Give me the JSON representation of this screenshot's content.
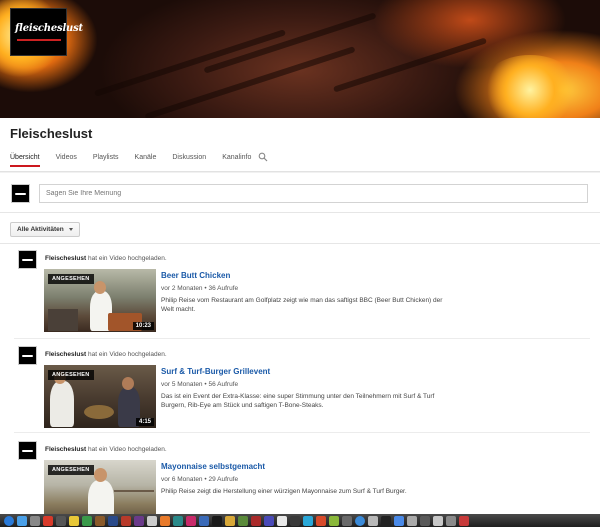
{
  "channel": {
    "logo_text": "fleischeslust",
    "title": "Fleischeslust"
  },
  "tabs": [
    {
      "label": "Übersicht",
      "active": true
    },
    {
      "label": "Videos",
      "active": false
    },
    {
      "label": "Playlists",
      "active": false
    },
    {
      "label": "Kanäle",
      "active": false
    },
    {
      "label": "Diskussion",
      "active": false
    },
    {
      "label": "Kanalinfo",
      "active": false
    }
  ],
  "share": {
    "placeholder": "Sagen Sie Ihre Meinung"
  },
  "filter": {
    "label": "Alle Aktivitäten"
  },
  "feed": [
    {
      "uploader": "Fleischeslust",
      "action": "hat ein Video hochgeladen.",
      "badge": "ANGESEHEN",
      "duration": "10:23",
      "title": "Beer Butt Chicken",
      "age": "vor 2 Monaten",
      "views": "36 Aufrufe",
      "description": "Philip Reise vom Restaurant am Golfplatz zeigt wie man das saftigst BBC (Beer Butt Chicken) der Welt macht."
    },
    {
      "uploader": "Fleischeslust",
      "action": "hat ein Video hochgeladen.",
      "badge": "ANGESEHEN",
      "duration": "4:15",
      "title": "Surf & Turf-Burger Grillevent",
      "age": "vor 5 Monaten",
      "views": "56 Aufrufe",
      "description": "Das ist ein Event der Extra-Klasse: eine super Stimmung unter den Teilnehmern mit Surf & Turf Burgern, Rib-Eye am Stück und saftigen T-Bone-Steaks."
    },
    {
      "uploader": "Fleischeslust",
      "action": "hat ein Video hochgeladen.",
      "badge": "ANGESEHEN",
      "duration": "",
      "title": "Mayonnaise selbstgemacht",
      "age": "vor 6 Monaten",
      "views": "29 Aufrufe",
      "description": "Philip Reise zeigt die Herstellung einer würzigen Mayonnaise zum Surf & Turf Burger."
    }
  ],
  "meta_separator": "•",
  "icons": {
    "search": "search-icon",
    "dropdown": "chevron-down-icon"
  },
  "colors": {
    "tab_active_underline": "#cc181e",
    "link": "#1b5aa8"
  }
}
